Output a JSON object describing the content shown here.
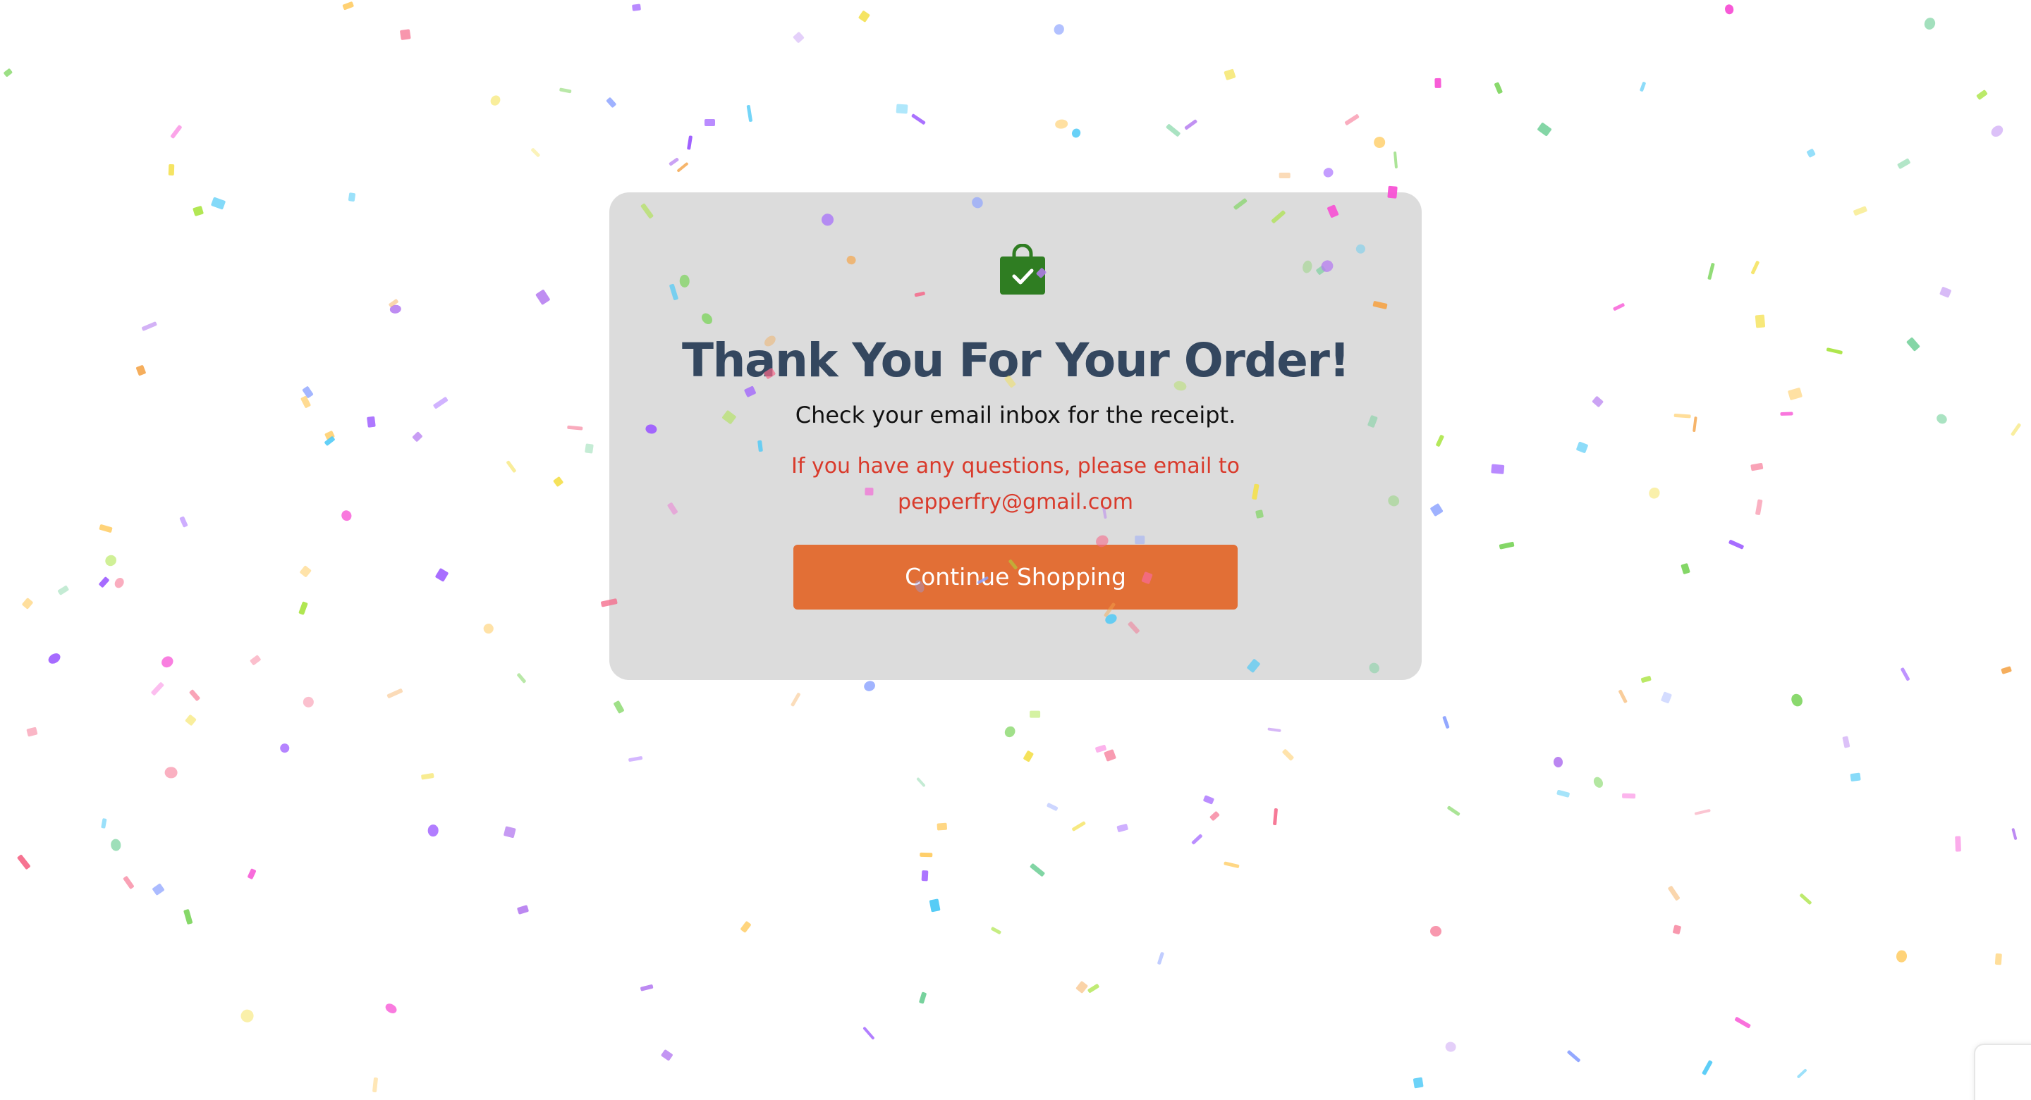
{
  "order_confirmation": {
    "title": "Thank You For Your Order!",
    "subtitle": "Check your email inbox for the receipt.",
    "contact_line1": "If you have any questions, please email to",
    "contact_email": "pepperfry@gmail.com",
    "continue_button_label": "Continue Shopping"
  },
  "icons": {
    "order_icon": "shopping-bag-check-icon"
  },
  "colors": {
    "card_background": "#dcdcdc",
    "title": "#34475f",
    "contact_text": "#d93a2b",
    "button": "#e26f36",
    "bag_icon": "#2f7d22"
  }
}
